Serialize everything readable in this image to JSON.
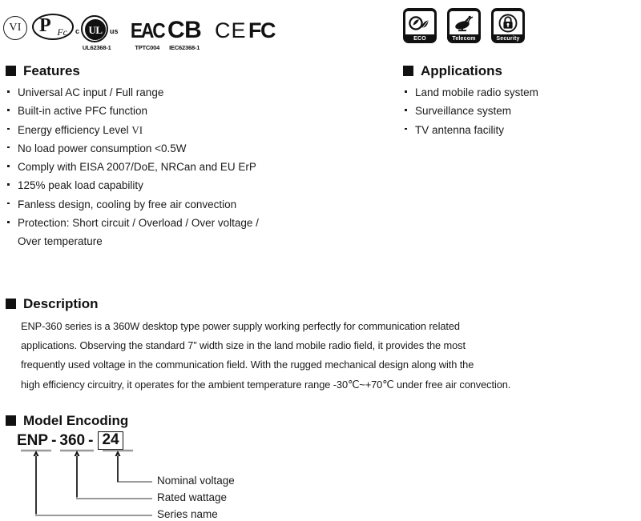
{
  "certifications": [
    {
      "id": "level-vi",
      "mark": "VI",
      "caption": ""
    },
    {
      "id": "pfc",
      "mark": "PFc",
      "caption": ""
    },
    {
      "id": "cul-us",
      "mark": "UL",
      "caption": "UL62368-1",
      "prefix": "c",
      "suffix": "us"
    },
    {
      "id": "eac",
      "mark": "EAC",
      "caption": "TPTC004"
    },
    {
      "id": "cb",
      "mark": "CB",
      "caption": "IEC62368-1"
    },
    {
      "id": "ce",
      "mark": "CE",
      "caption": ""
    },
    {
      "id": "fcc",
      "mark": "FC",
      "caption": ""
    }
  ],
  "badges": [
    {
      "id": "eco",
      "label": "ECO",
      "icon": "leaf-icon"
    },
    {
      "id": "telecom",
      "label": "Telecom",
      "icon": "satellite-dish-icon"
    },
    {
      "id": "security",
      "label": "Security",
      "icon": "lock-icon"
    }
  ],
  "features": {
    "title": "Features",
    "items": [
      {
        "text": "Universal AC input / Full range"
      },
      {
        "text": "Built-in active PFC function"
      },
      {
        "text": "Energy efficiency Level ",
        "suffix_serif": "VI"
      },
      {
        "text": "No load power consumption <0.5W"
      },
      {
        "text": "Comply with EISA 2007/DoE, NRCan and EU ErP"
      },
      {
        "text": "125% peak load capability"
      },
      {
        "text": "Fanless design, cooling by free air convection"
      },
      {
        "text": "Protection: Short circuit / Overload / Over voltage /"
      },
      {
        "text": "Over temperature",
        "continuation": true
      }
    ]
  },
  "applications": {
    "title": "Applications",
    "items": [
      {
        "text": "Land mobile radio system"
      },
      {
        "text": "Surveillance system"
      },
      {
        "text": "TV antenna facility"
      }
    ]
  },
  "description": {
    "title": "Description",
    "paragraphs": [
      "ENP-360 series is a 360W desktop type power supply working perfectly for communication related",
      "applications. Observing the standard 7” width size in the land mobile radio field, it provides the most",
      "frequently used voltage in the communication field. With the rugged mechanical design along with the",
      "high efficiency circuitry, it operates for the ambient temperature range -30℃~+70℃ under free air convection."
    ]
  },
  "model_encoding": {
    "title": "Model Encoding",
    "code": {
      "series": "ENP",
      "dash1": "-",
      "wattage": "360",
      "dash2": "-",
      "voltage": "24"
    },
    "legend": [
      {
        "label": "Nominal voltage"
      },
      {
        "label": "Rated wattage"
      },
      {
        "label": "Series name"
      }
    ]
  },
  "colors": {
    "ink": "#1b1b1b",
    "heading": "#111111",
    "leader": "#9a9a9a",
    "page": "#ffffff"
  }
}
